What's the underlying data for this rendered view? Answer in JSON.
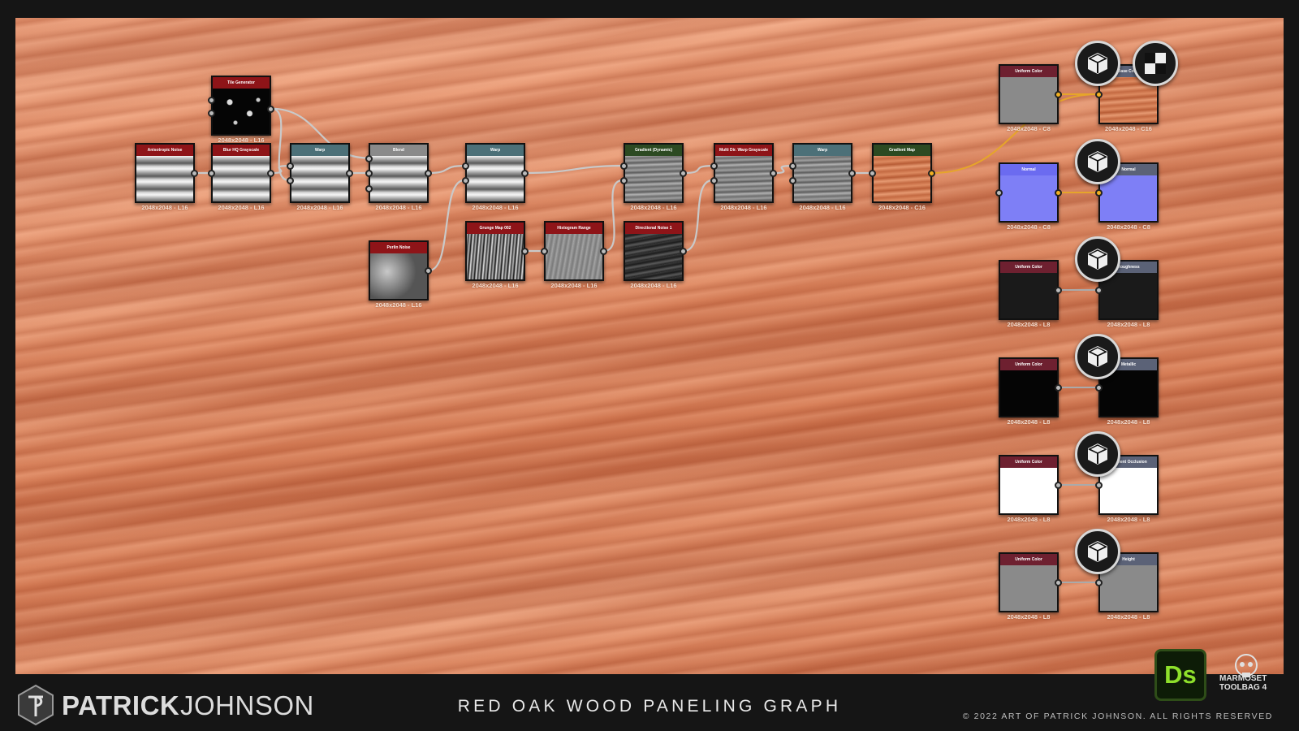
{
  "graph": {
    "nodes": [
      {
        "id": "aniso",
        "title": "Anisotropic Noise",
        "res": "2048x2048 - L16",
        "header": "#8e1418",
        "preview": "stripes"
      },
      {
        "id": "tile",
        "title": "Tile Generator",
        "res": "2048x2048 - L16",
        "header": "#8e1418",
        "preview": "dots"
      },
      {
        "id": "blur",
        "title": "Blur HQ Grayscale",
        "res": "2048x2048 - L16",
        "header": "#8e1418",
        "preview": "stripes"
      },
      {
        "id": "warp1",
        "title": "Warp",
        "res": "2048x2048 - L16",
        "header": "#4c7078",
        "preview": "stripes"
      },
      {
        "id": "blend",
        "title": "Blend",
        "res": "2048x2048 - L16",
        "header": "#8a8a8a",
        "preview": "stripes"
      },
      {
        "id": "warp2",
        "title": "Warp",
        "res": "2048x2048 - L16",
        "header": "#4c7078",
        "preview": "stripes"
      },
      {
        "id": "perlin",
        "title": "Perlin Noise",
        "res": "2048x2048 - L16",
        "header": "#8e1418",
        "preview": "clouds"
      },
      {
        "id": "grunge",
        "title": "Grunge Map 002",
        "res": "2048x2048 - L16",
        "header": "#8e1418",
        "preview": "grunge"
      },
      {
        "id": "histo",
        "title": "Histogram Range",
        "res": "2048x2048 - L16",
        "header": "#8e1418",
        "preview": "gray"
      },
      {
        "id": "gradient",
        "title": "Gradient (Dynamic)",
        "res": "2048x2048 - L16",
        "header": "#2c4a22",
        "preview": "woodgray"
      },
      {
        "id": "dirnoise",
        "title": "Directional Noise 1",
        "res": "2048x2048 - L16",
        "header": "#8e1418",
        "preview": "dark"
      },
      {
        "id": "multidir",
        "title": "Multi Dir. Warp Grayscale",
        "res": "2048x2048 - L16",
        "header": "#8e1418",
        "preview": "woodgray"
      },
      {
        "id": "warp3",
        "title": "Warp",
        "res": "2048x2048 - L16",
        "header": "#4c7078",
        "preview": "woodgray"
      },
      {
        "id": "gradmap",
        "title": "Gradient Map",
        "res": "2048x2048 - C16",
        "header": "#2c4a22",
        "preview": "woodcolor"
      },
      {
        "id": "uc1",
        "title": "Uniform Color",
        "res": "2048x2048 - C8",
        "header": "#6e2030",
        "preview": "mid"
      },
      {
        "id": "out_base",
        "title": "Base Color",
        "res": "2048x2048 - C16",
        "header": "#5b6277",
        "preview": "woodcolor"
      },
      {
        "id": "normal",
        "title": "Normal",
        "res": "2048x2048 - C8",
        "header": "#6b6bf0",
        "preview": "normal"
      },
      {
        "id": "out_normal",
        "title": "Normal",
        "res": "2048x2048 - C8",
        "header": "#5b6277",
        "preview": "normal"
      },
      {
        "id": "uc2",
        "title": "Uniform Color",
        "res": "2048x2048 - L8",
        "header": "#6e2030",
        "preview": "black1"
      },
      {
        "id": "out_rough",
        "title": "Roughness",
        "res": "2048x2048 - L8",
        "header": "#5b6277",
        "preview": "black1"
      },
      {
        "id": "uc3",
        "title": "Uniform Color",
        "res": "2048x2048 - L8",
        "header": "#6e2030",
        "preview": "black2"
      },
      {
        "id": "out_metal",
        "title": "Metallic",
        "res": "2048x2048 - L8",
        "header": "#5b6277",
        "preview": "black2"
      },
      {
        "id": "uc4",
        "title": "Uniform Color",
        "res": "2048x2048 - L8",
        "header": "#6e2030",
        "preview": "white"
      },
      {
        "id": "out_ao",
        "title": "Ambient Occlusion",
        "res": "2048x2048 - L8",
        "header": "#5b6277",
        "preview": "white"
      },
      {
        "id": "uc5",
        "title": "Uniform Color",
        "res": "2048x2048 - L8",
        "header": "#6e2030",
        "preview": "mid"
      },
      {
        "id": "out_height",
        "title": "Height",
        "res": "2048x2048 - L8",
        "header": "#5b6277",
        "preview": "mid"
      }
    ],
    "badges": [
      {
        "id": "base",
        "icon": "cube-icon"
      },
      {
        "id": "base2",
        "icon": "checker-icon"
      },
      {
        "id": "normal",
        "icon": "cube-icon"
      },
      {
        "id": "rough",
        "icon": "cube-icon"
      },
      {
        "id": "metal",
        "icon": "cube-icon"
      },
      {
        "id": "ao",
        "icon": "cube-icon"
      },
      {
        "id": "height",
        "icon": "cube-icon"
      }
    ]
  },
  "footer": {
    "author_first": "PATRICK",
    "author_last": "JOHNSON",
    "title": "RED OAK WOOD PANELING GRAPH",
    "copyright": "© 2022 ART OF PATRICK JOHNSON. ALL RIGHTS RESERVED",
    "ds_label": "Ds",
    "marmoset_line1": "MARMOSET",
    "marmoset_line2": "TOOLBAG 4"
  }
}
